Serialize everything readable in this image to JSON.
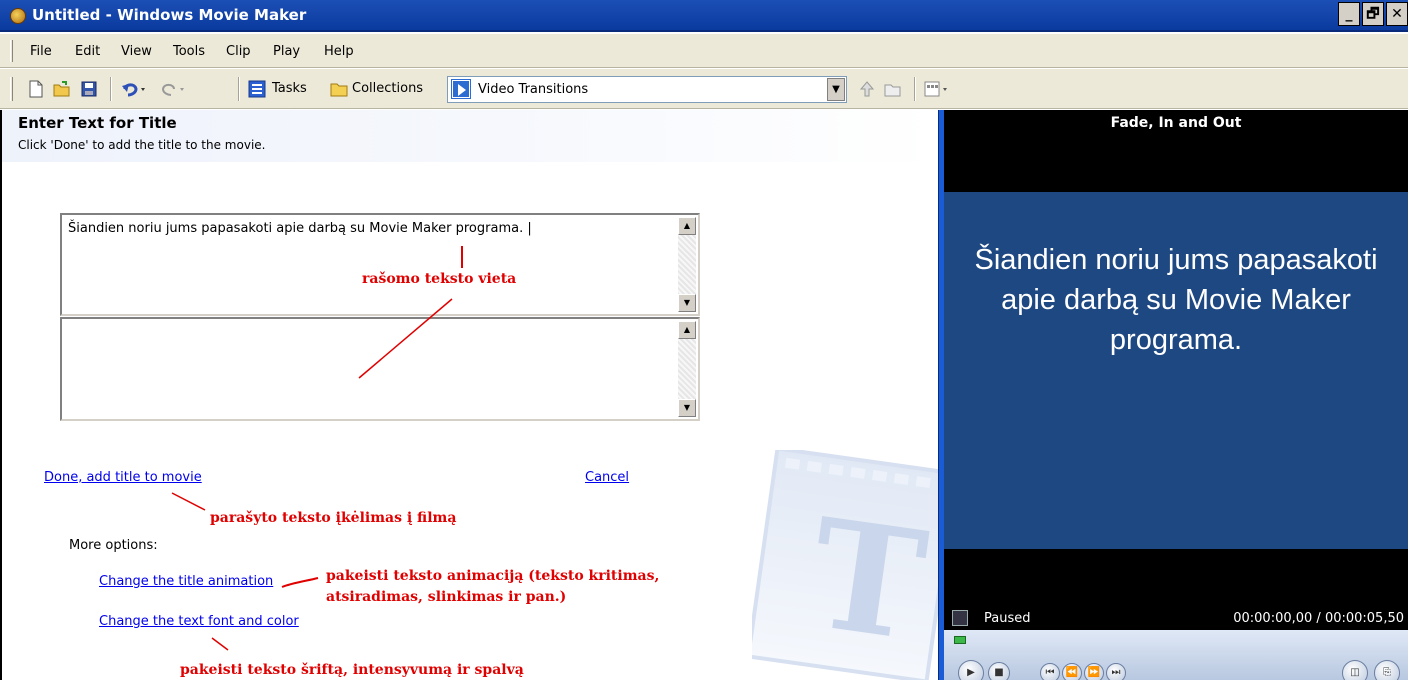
{
  "window": {
    "title": "Untitled - Windows Movie Maker",
    "buttons": [
      "_",
      "🗗",
      "✕"
    ]
  },
  "menu": [
    "File",
    "Edit",
    "View",
    "Tools",
    "Clip",
    "Play",
    "Help"
  ],
  "toolbar": {
    "tasks_label": "Tasks",
    "collections_label": "Collections",
    "collection_selected": "Video Transitions"
  },
  "task_pane": {
    "title": "Enter Text for Title",
    "subtitle": "Click 'Done' to add the title to the movie.",
    "textbox1_value": "Šiandien noriu jums papasakoti apie darbą su Movie Maker programa. |",
    "textbox2_value": "",
    "done_link": "Done, add title to movie",
    "cancel_link": "Cancel",
    "more_options_label": "More options:",
    "change_animation_link": "Change the title animation",
    "change_font_link": "Change the text font and color"
  },
  "annotations": {
    "text_area": "rašomo teksto vieta",
    "add_to_movie": "parašyto teksto įkėlimas į filmą",
    "animation_line1": "pakeisti teksto animaciją (teksto kritimas,",
    "animation_line2": "atsiradimas, slinkimas ir pan.)",
    "font_color": "pakeisti teksto šriftą, intensyvumą ir spalvą"
  },
  "preview": {
    "title": "Fade, In and Out",
    "text": "Šiandien noriu jums papasakoti apie darbą su Movie Maker programa.",
    "status": "Paused",
    "time": "00:00:00,00 / 00:00:05,50",
    "bg_color": "#1e4882"
  }
}
